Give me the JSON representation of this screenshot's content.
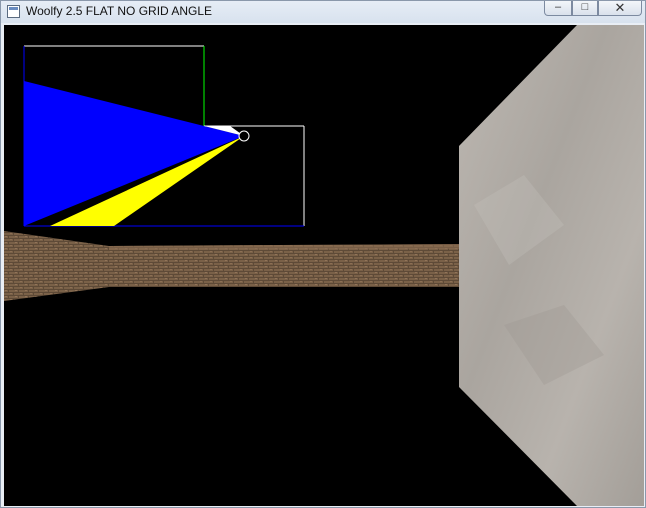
{
  "window": {
    "title": "Woolfy 2.5 FLAT NO GRID ANGLE",
    "controls": {
      "minimize_glyph": "–",
      "maximize_glyph": "□",
      "close_glyph": "✕"
    }
  },
  "colors": {
    "background": "#000000",
    "brick_wall": "#7a6148",
    "stone_wall": "#b3aea8",
    "minimap_fov_primary": "#0000ff",
    "minimap_fov_secondary": "#ffff00",
    "minimap_border": "#ffffff",
    "minimap_border_green": "#00ff00"
  },
  "icons": {
    "app": "window-app-icon",
    "player": "player-circle-icon"
  }
}
